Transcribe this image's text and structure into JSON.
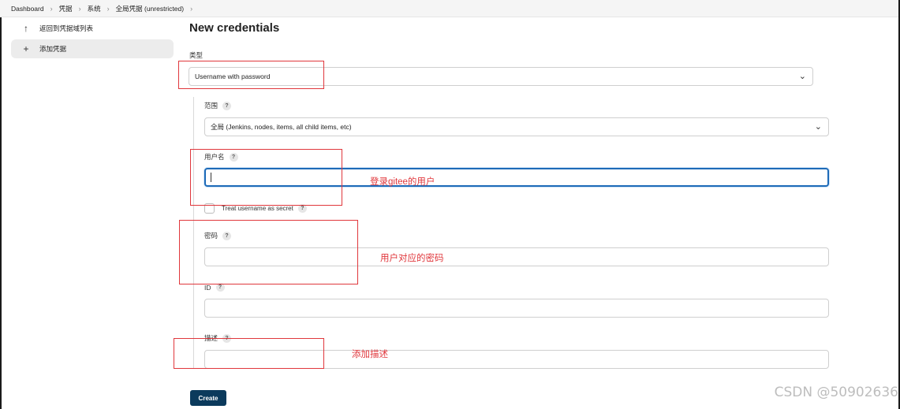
{
  "breadcrumb": [
    "Dashboard",
    "凭据",
    "系统",
    "全局凭据 (unrestricted)"
  ],
  "sidebar": {
    "items": [
      {
        "icon": "arrow-up-icon",
        "label": "返回到凭据域列表"
      },
      {
        "icon": "plus-icon",
        "label": "添加凭据"
      }
    ]
  },
  "page": {
    "title": "New credentials"
  },
  "form": {
    "kind_label": "类型",
    "kind_value": "Username with password",
    "scope_label": "范围",
    "scope_value": "全局 (Jenkins, nodes, items, all child items, etc)",
    "username_label": "用户名",
    "username_value": "",
    "treat_secret_label": "Treat username as secret",
    "password_label": "密码",
    "password_value": "",
    "id_label": "ID",
    "id_value": "",
    "description_label": "描述",
    "description_value": "",
    "create_label": "Create"
  },
  "annotations": {
    "username_note": "登录gitee的用户",
    "password_note": "用户对应的密码",
    "description_note": "添加描述",
    "color": "#e0373c"
  },
  "watermark": "CSDN @50902636",
  "colors": {
    "focus": "#1e6bb8",
    "button": "#0b3a5c"
  }
}
